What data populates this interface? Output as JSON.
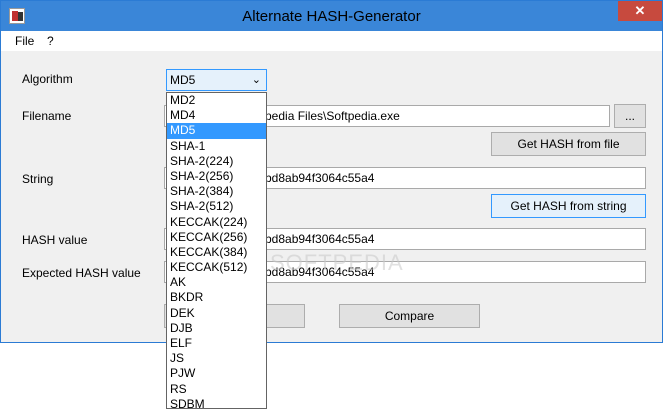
{
  "window": {
    "title": "Alternate HASH-Generator",
    "close_glyph": "✕"
  },
  "menu": [
    {
      "label": "File"
    },
    {
      "label": "?"
    }
  ],
  "labels": {
    "algorithm": "Algorithm",
    "filename": "Filename",
    "string": "String",
    "hash_value": "HASH value",
    "expected_hash": "Expected HASH value"
  },
  "algorithm": {
    "selected": "MD5",
    "options": [
      "MD2",
      "MD4",
      "MD5",
      "SHA-1",
      "SHA-2(224)",
      "SHA-2(256)",
      "SHA-2(384)",
      "SHA-2(512)",
      "KECCAK(224)",
      "KECCAK(256)",
      "KECCAK(384)",
      "KECCAK(512)",
      "AK",
      "BKDR",
      "DEK",
      "DJB",
      "ELF",
      "JS",
      "PJW",
      "RS",
      "SDBM"
    ],
    "highlighted_index": 2
  },
  "fields": {
    "filename_visible": "pedia Files\\Softpedia.exe",
    "string_visible": "bd8ab94f3064c55a4",
    "hash_visible": "bd8ab94f3064c55a4",
    "expected_visible": "bd8ab94f3064c55a4"
  },
  "buttons": {
    "browse": "...",
    "hash_file": "Get HASH from file",
    "hash_string": "Get HASH from string",
    "compare": "Compare"
  },
  "watermark": "SOFTPEDIA",
  "colors": {
    "titlebar": "#3a86d8",
    "close": "#c74a3e",
    "selection": "#3399ff"
  }
}
